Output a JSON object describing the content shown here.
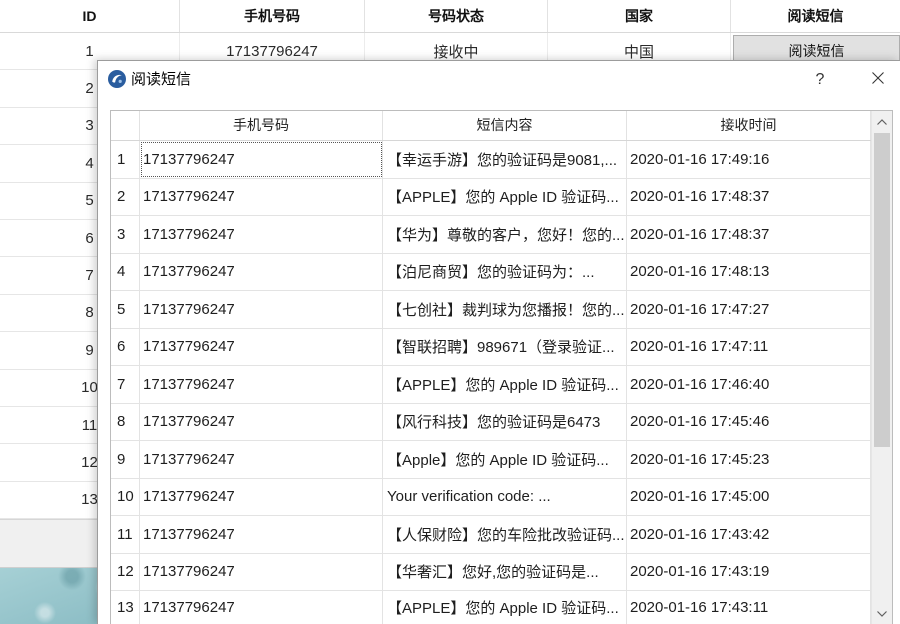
{
  "main_table": {
    "headers": {
      "id": "ID",
      "phone": "手机号码",
      "status": "号码状态",
      "country": "国家",
      "action": "阅读短信"
    },
    "rows": [
      {
        "id": "1",
        "phone": "17137796247",
        "status": "接收中",
        "country": "中国",
        "action": "阅读短信"
      },
      {
        "id": "2"
      },
      {
        "id": "3"
      },
      {
        "id": "4"
      },
      {
        "id": "5"
      },
      {
        "id": "6"
      },
      {
        "id": "7"
      },
      {
        "id": "8"
      },
      {
        "id": "9"
      },
      {
        "id": "10"
      },
      {
        "id": "11"
      },
      {
        "id": "12"
      },
      {
        "id": "13"
      }
    ]
  },
  "dialog": {
    "title": "阅读短信",
    "help_label": "?",
    "headers": {
      "phone": "手机号码",
      "content": "短信内容",
      "time": "接收时间"
    },
    "rows": [
      {
        "index": "1",
        "phone": "17137796247",
        "content": "【幸运手游】您的验证码是9081,...",
        "time": "2020-01-16 17:49:16"
      },
      {
        "index": "2",
        "phone": "17137796247",
        "content": "【APPLE】您的 Apple ID 验证码...",
        "time": "2020-01-16 17:48:37"
      },
      {
        "index": "3",
        "phone": "17137796247",
        "content": "【华为】尊敬的客户，您好！您的...",
        "time": "2020-01-16 17:48:37"
      },
      {
        "index": "4",
        "phone": "17137796247",
        "content": "【泊尼商贸】您的验证码为：...",
        "time": "2020-01-16 17:48:13"
      },
      {
        "index": "5",
        "phone": "17137796247",
        "content": "【七创社】裁判球为您播报！您的...",
        "time": "2020-01-16 17:47:27"
      },
      {
        "index": "6",
        "phone": "17137796247",
        "content": "【智联招聘】989671（登录验证...",
        "time": "2020-01-16 17:47:11"
      },
      {
        "index": "7",
        "phone": "17137796247",
        "content": "【APPLE】您的 Apple ID 验证码...",
        "time": "2020-01-16 17:46:40"
      },
      {
        "index": "8",
        "phone": "17137796247",
        "content": "【风行科技】您的验证码是6473",
        "time": "2020-01-16 17:45:46"
      },
      {
        "index": "9",
        "phone": "17137796247",
        "content": "【Apple】您的 Apple ID 验证码...",
        "time": "2020-01-16 17:45:23"
      },
      {
        "index": "10",
        "phone": "17137796247",
        "content": "Your verification code: ...",
        "time": "2020-01-16 17:45:00"
      },
      {
        "index": "11",
        "phone": "17137796247",
        "content": "【人保财险】您的车险批改验证码...",
        "time": "2020-01-16 17:43:42"
      },
      {
        "index": "12",
        "phone": "17137796247",
        "content": "【华奢汇】您好,您的验证码是...",
        "time": "2020-01-16 17:43:19"
      },
      {
        "index": "13",
        "phone": "17137796247",
        "content": "【APPLE】您的 Apple ID 验证码...",
        "time": "2020-01-16 17:43:11"
      }
    ]
  },
  "icons": {
    "dialog_logo": "app-logo-icon",
    "close": "close-icon",
    "scroll_up": "chevron-up-icon",
    "scroll_down": "chevron-down-icon"
  },
  "colors": {
    "action_button_bg": "#e1e1e1",
    "scrollbar_thumb": "#cdcdcd",
    "logo_blue": "#2a5d9f"
  }
}
